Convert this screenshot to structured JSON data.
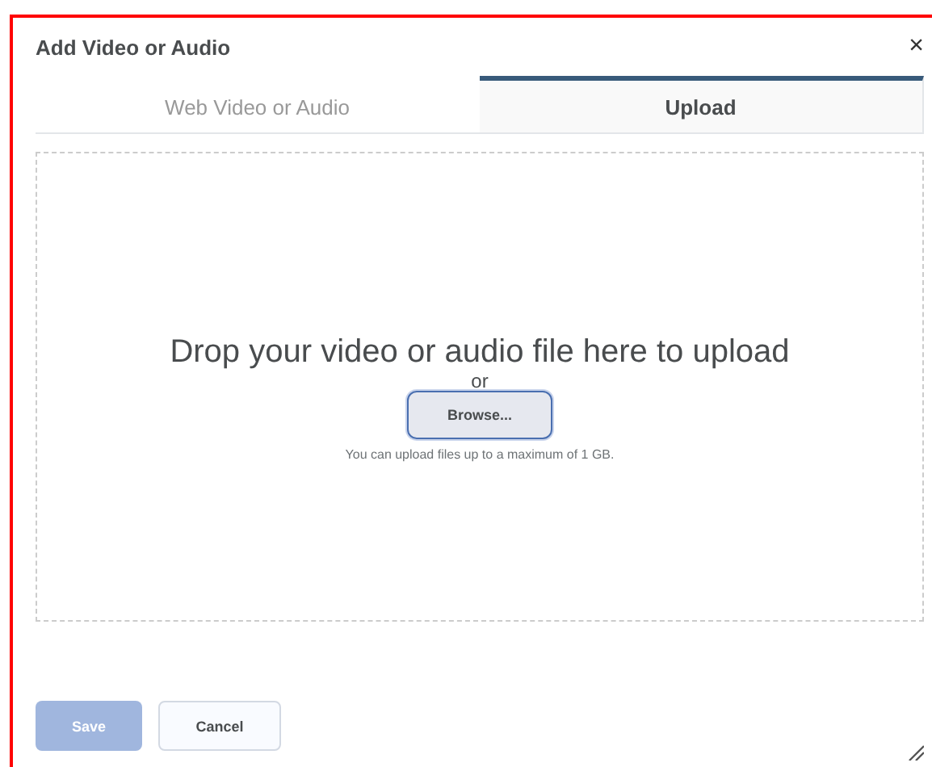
{
  "dialog": {
    "title": "Add Video or Audio",
    "close": "×"
  },
  "tabs": [
    {
      "label": "Web Video or Audio",
      "selected": false
    },
    {
      "label": "Upload",
      "selected": true
    }
  ],
  "drop_zone": {
    "heading": "Drop your video or audio file here to upload",
    "or": "or",
    "browse": "Browse...",
    "hint": "You can upload files up to a maximum of 1 GB."
  },
  "buttons": [
    {
      "label": "Save",
      "kind": "primary",
      "disabled": true
    },
    {
      "label": "Cancel",
      "kind": "secondary",
      "disabled": false
    }
  ]
}
